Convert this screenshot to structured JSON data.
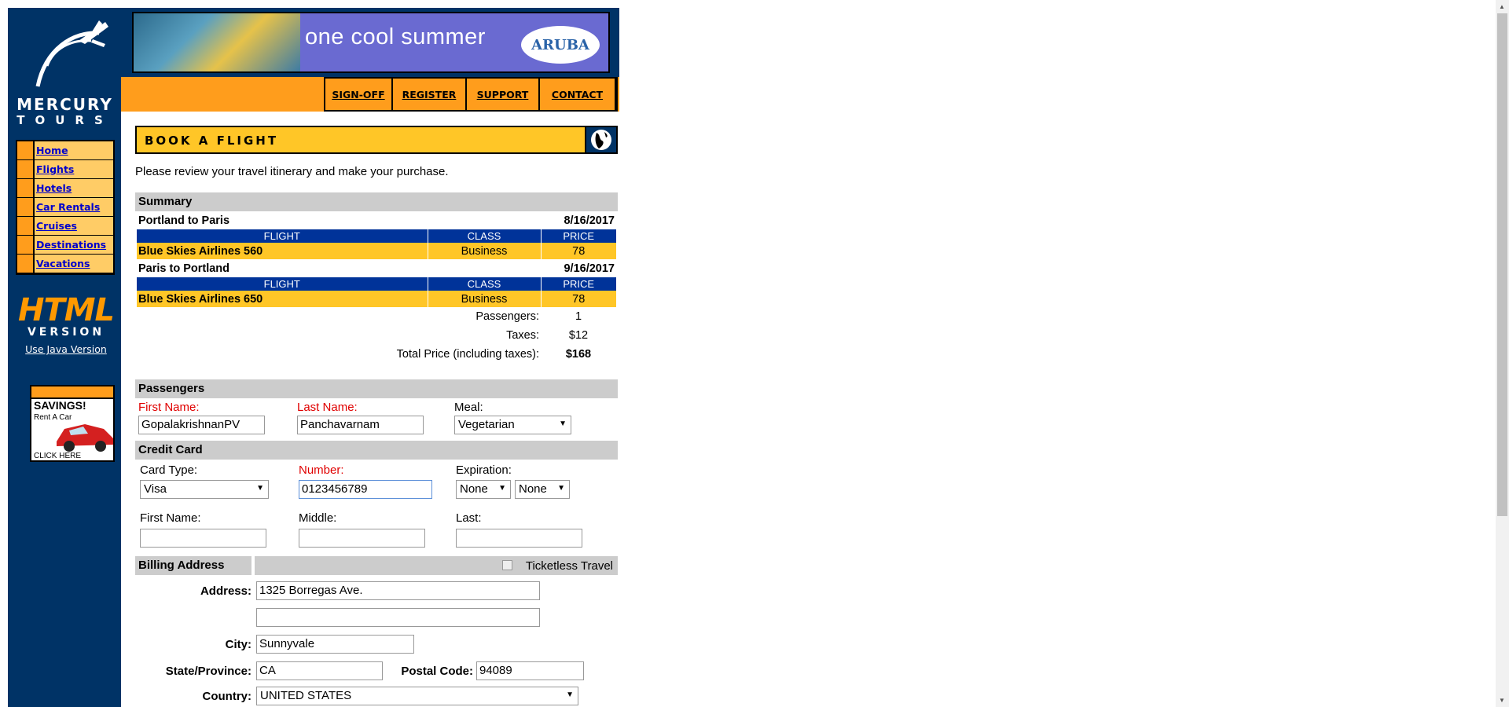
{
  "sidebar": {
    "logo_line1": "MERCURY",
    "logo_line2": "TOURS",
    "items": [
      "Home",
      "Flights",
      "Hotels",
      "Car Rentals",
      "Cruises",
      "Destinations",
      "Vacations"
    ],
    "html_version_big": "HTML",
    "html_version_small": "VERSION",
    "java_link": "Use Java Version",
    "ad": {
      "title": "SAVINGS!",
      "subtitle": "Rent A Car",
      "cta": "CLICK HERE"
    }
  },
  "banner": {
    "slogan": "one cool summer",
    "brand": "ARUBA"
  },
  "topnav": [
    "SIGN-OFF",
    "REGISTER",
    "SUPPORT",
    "CONTACT"
  ],
  "page": {
    "title": "BOOK A FLIGHT",
    "intro": "Please review your travel itinerary and make your purchase."
  },
  "summary": {
    "heading": "Summary",
    "columns": [
      "FLIGHT",
      "CLASS",
      "PRICE"
    ],
    "legs": [
      {
        "route": "Portland to Paris",
        "date": "8/16/2017",
        "flight": "Blue Skies Airlines 560",
        "class": "Business",
        "price": "78"
      },
      {
        "route": "Paris to Portland",
        "date": "9/16/2017",
        "flight": "Blue Skies Airlines 650",
        "class": "Business",
        "price": "78"
      }
    ],
    "passengers_label": "Passengers:",
    "passengers_value": "1",
    "taxes_label": "Taxes:",
    "taxes_value": "$12",
    "total_label": "Total Price (including taxes):",
    "total_value": "$168"
  },
  "passengers": {
    "heading": "Passengers",
    "first_label": "First Name:",
    "last_label": "Last Name:",
    "meal_label": "Meal:",
    "first_value": "GopalakrishnanPV",
    "last_value": "Panchavarnam",
    "meal_value": "Vegetarian"
  },
  "credit": {
    "heading": "Credit Card",
    "type_label": "Card Type:",
    "number_label": "Number:",
    "exp_label": "Expiration:",
    "type_value": "Visa",
    "number_value": "0123456789",
    "exp_month": "None",
    "exp_year": "None",
    "first_label": "First Name:",
    "middle_label": "Middle:",
    "last_label": "Last:"
  },
  "billing": {
    "heading": "Billing Address",
    "ticketless": "Ticketless Travel",
    "address_label": "Address:",
    "address1": "1325 Borregas Ave.",
    "address2": "",
    "city_label": "City:",
    "city": "Sunnyvale",
    "state_label": "State/Province:",
    "state": "CA",
    "postal_label": "Postal Code:",
    "postal": "94089",
    "country_label": "Country:",
    "country": "UNITED STATES"
  }
}
